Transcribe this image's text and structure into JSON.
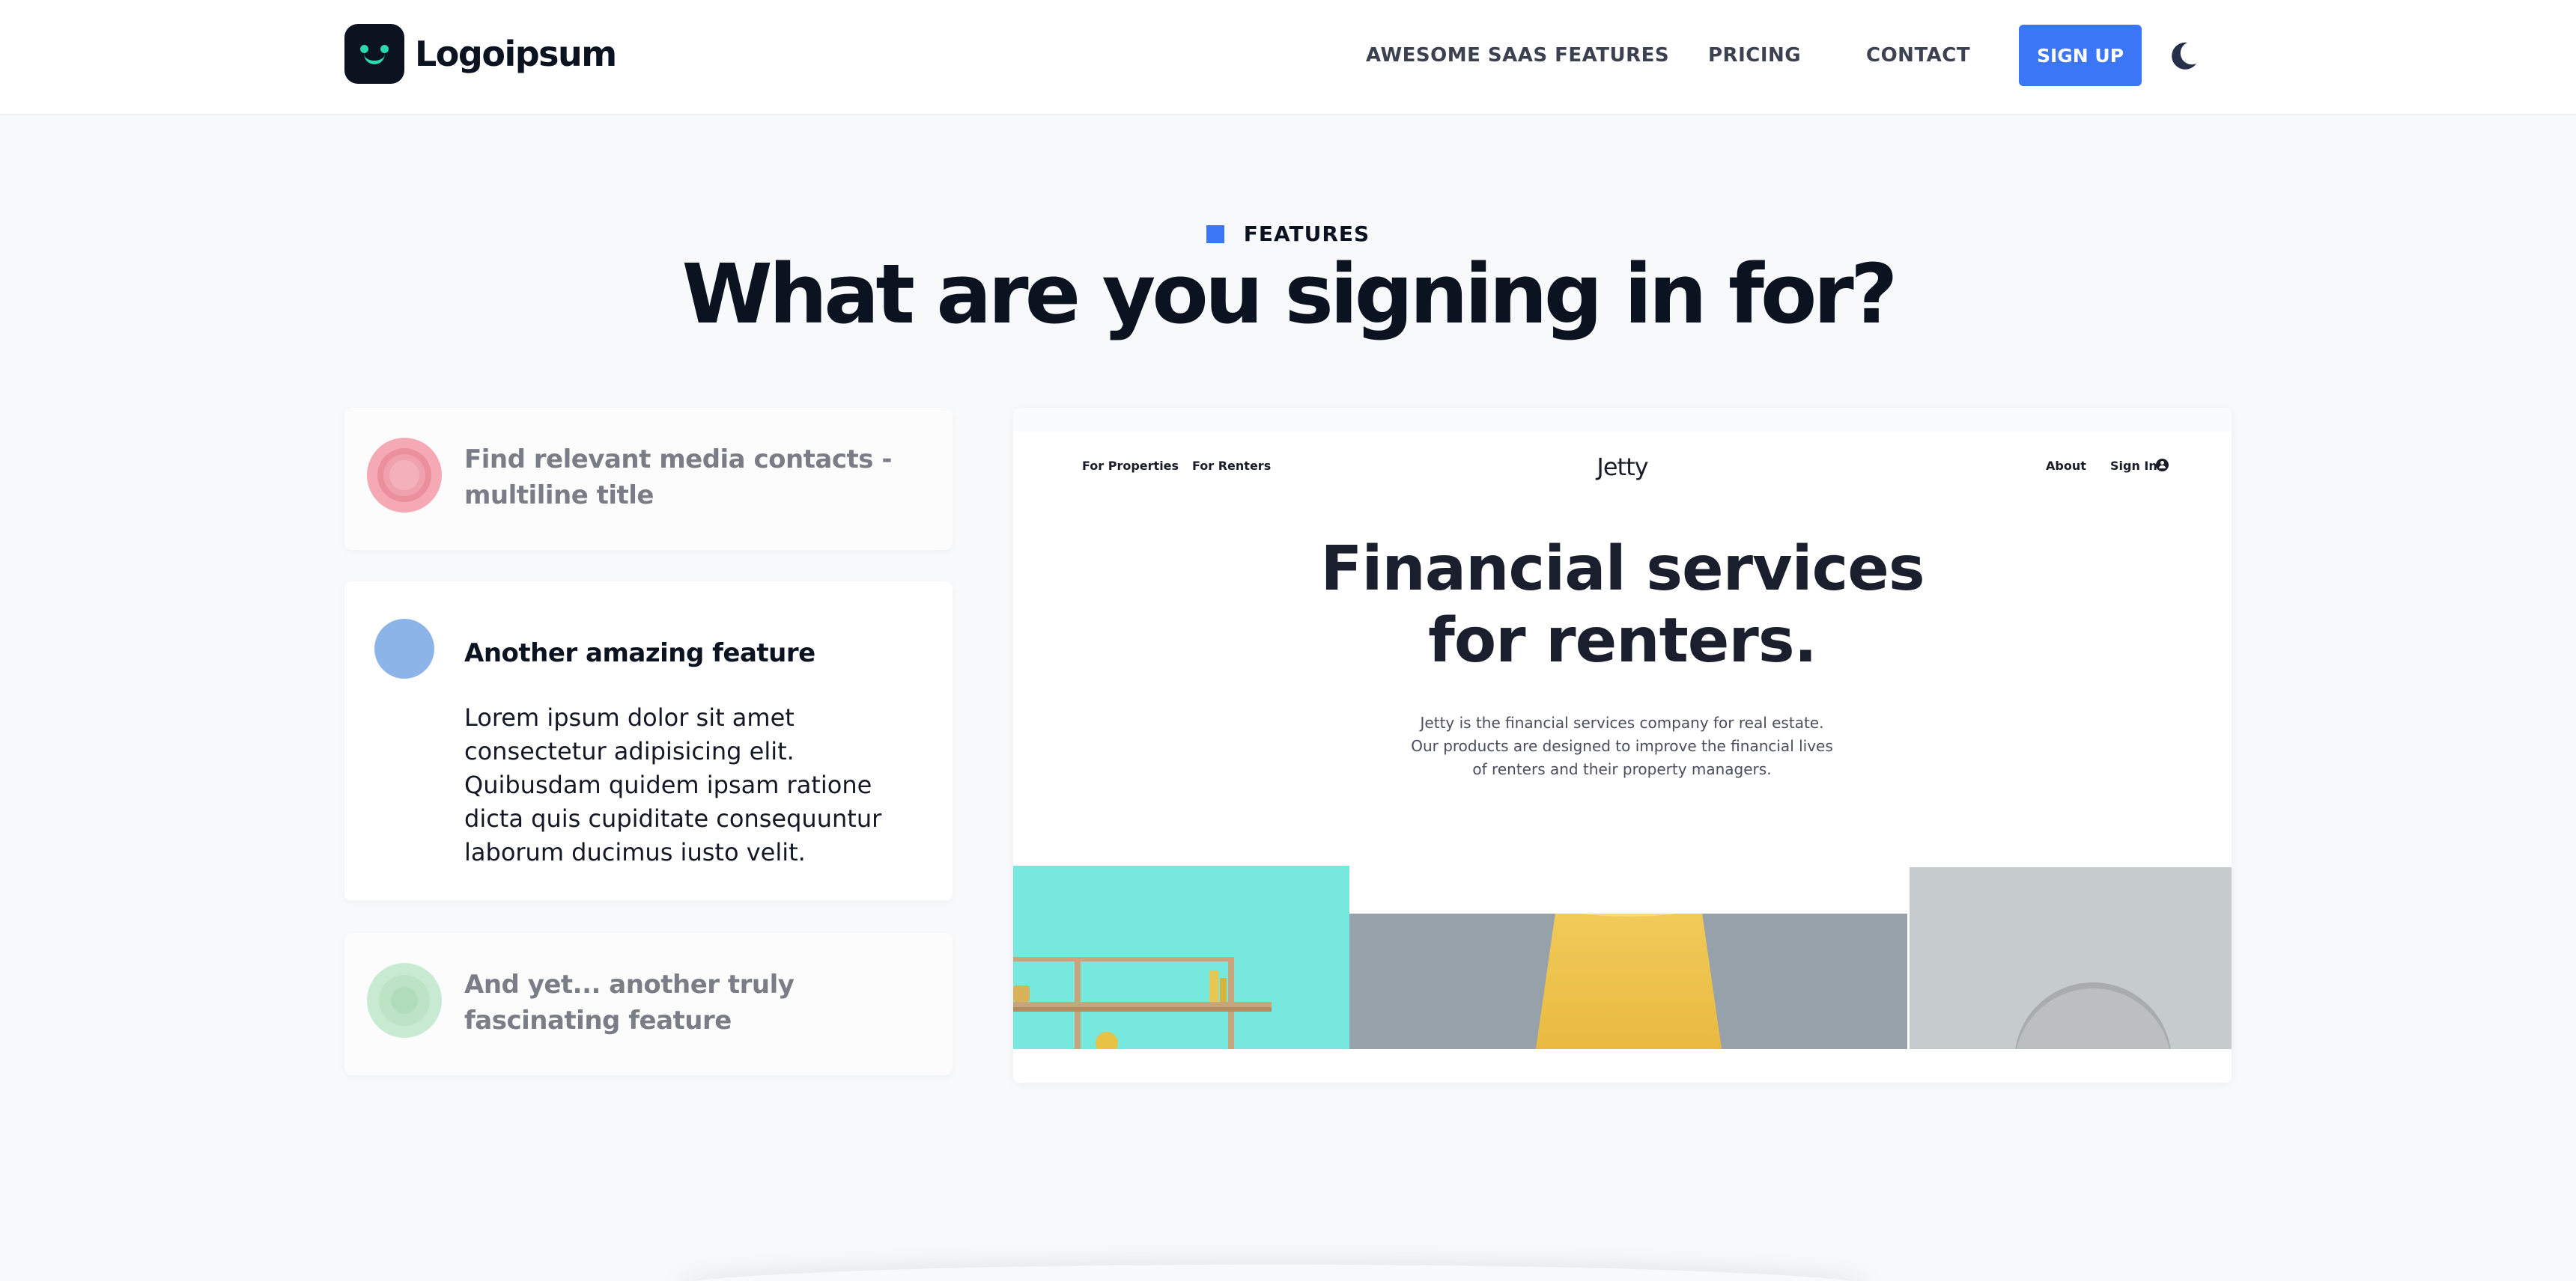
{
  "header": {
    "logo_text": "Logoipsum",
    "nav": [
      "AWESOME SAAS FEATURES",
      "PRICING",
      "CONTACT"
    ],
    "signup_label": "SIGN UP",
    "theme_toggle_icon": "moon-icon"
  },
  "section": {
    "eyebrow": "FEATURES",
    "title": "What are you signing in for?"
  },
  "features": [
    {
      "title": "Find relevant media contacts - multiline title",
      "body": "",
      "color": "#f4a9b4",
      "active": false
    },
    {
      "title": "Another amazing feature",
      "body": "Lorem ipsum dolor sit amet consectetur adipisicing elit. Quibusdam quidem ipsam ratione dicta quis cupiditate consequuntur laborum ducimus iusto velit.",
      "color": "#8db4e8",
      "active": true
    },
    {
      "title": "And yet... another truly fascinating feature",
      "body": "",
      "color": "#c9ead2",
      "active": false
    }
  ],
  "preview": {
    "nav_left": [
      "For Properties",
      "For Renters"
    ],
    "brand": "Jetty",
    "nav_right": [
      "About",
      "Sign In"
    ],
    "headline_line1": "Financial services",
    "headline_line2": "for renters.",
    "subtext_line1": "Jetty is the financial services company for real estate.",
    "subtext_line2": "Our products are designed to improve the financial lives",
    "subtext_line3": "of renters and their property managers."
  },
  "colors": {
    "accent": "#3b76f6",
    "background": "#f8f9fb",
    "heading": "#0b1220"
  }
}
